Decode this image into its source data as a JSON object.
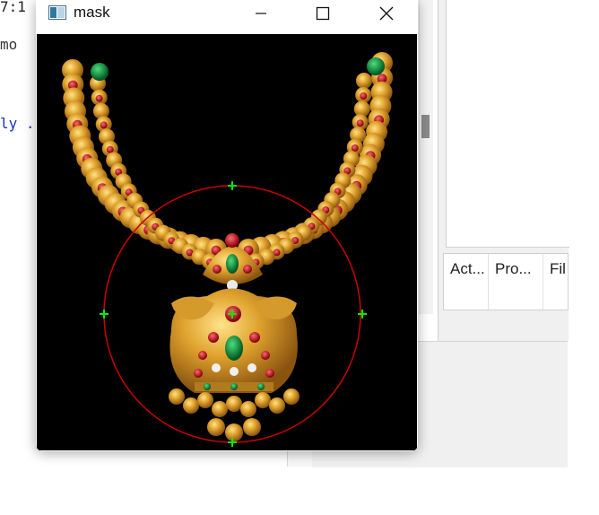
{
  "editor": {
    "line1": "7:1",
    "line2": " mo",
    "line3": "ly ."
  },
  "panel": {
    "columns": [
      "Act...",
      "Pro...",
      "Fil"
    ]
  },
  "window": {
    "title": "mask",
    "icon": "app-window-icon",
    "controls": [
      "minimize-icon",
      "maximize-icon",
      "close-icon"
    ]
  },
  "canvas": {
    "subject": "gold necklace with pendant",
    "circle_color": "#cc0000",
    "marker_color": "#00ee00"
  }
}
